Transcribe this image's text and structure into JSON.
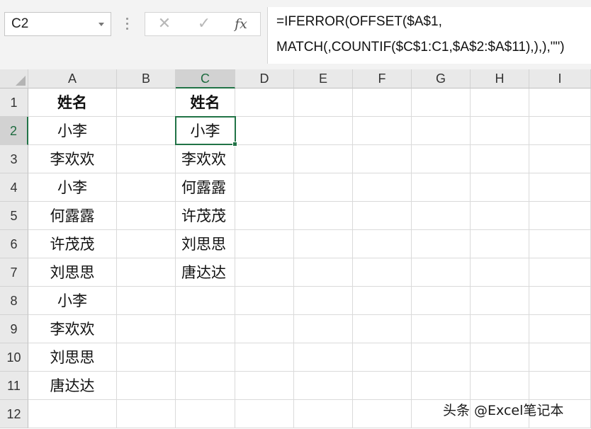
{
  "name_box": {
    "value": "C2"
  },
  "formula_bar": {
    "cancel_symbol": "✕",
    "enter_symbol": "✓",
    "fx_label": "fx",
    "formula_line1": "=IFERROR(OFFSET($A$1,",
    "formula_line2": "MATCH(,COUNTIF($C$1:C1,$A$2:$A$11),),),\"\")"
  },
  "columns": [
    "A",
    "B",
    "C",
    "D",
    "E",
    "F",
    "G",
    "H",
    "I"
  ],
  "rows": [
    "1",
    "2",
    "3",
    "4",
    "5",
    "6",
    "7",
    "8",
    "9",
    "10",
    "11",
    "12"
  ],
  "active_cell": {
    "column": "C",
    "row": "2"
  },
  "sheet": {
    "A": [
      "姓名",
      "小李",
      "李欢欢",
      "小李",
      "何露露",
      "许茂茂",
      "刘思思",
      "小李",
      "李欢欢",
      "刘思思",
      "唐达达",
      ""
    ],
    "C": [
      "姓名",
      "小李",
      "李欢欢",
      "何露露",
      "许茂茂",
      "刘思思",
      "唐达达",
      "",
      "",
      "",
      "",
      ""
    ]
  },
  "watermark": "头条 @Excel笔记本",
  "colors": {
    "accent": "#217346",
    "header_bg": "#e9e9e9",
    "selected_header_bg": "#d2d2d2"
  }
}
